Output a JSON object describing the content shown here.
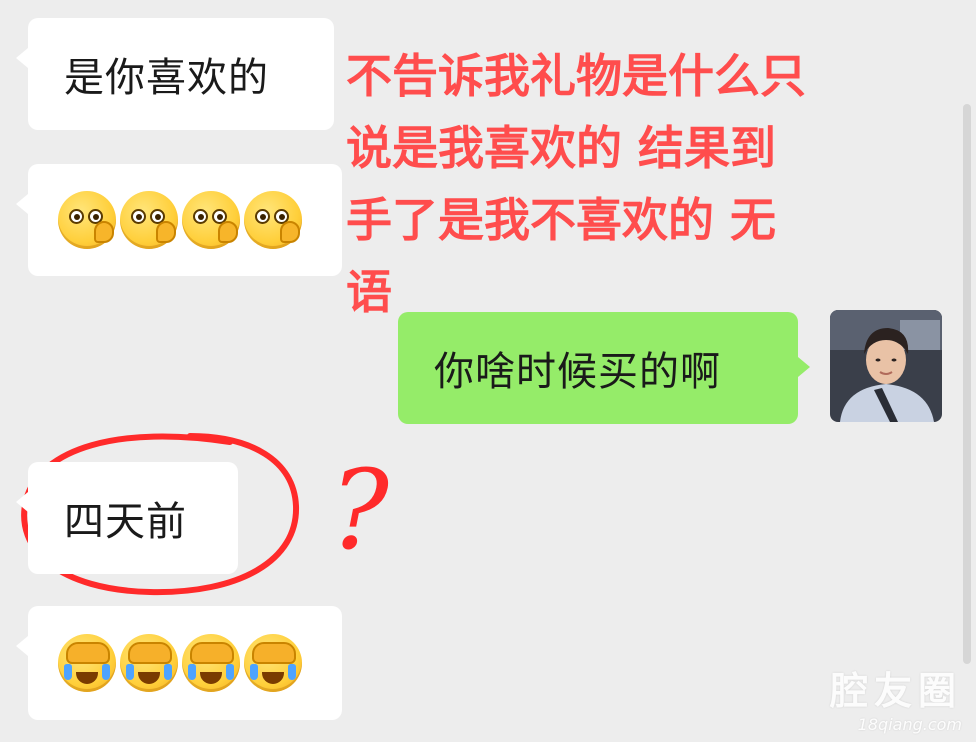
{
  "messages": [
    {
      "side": "left",
      "text": "是你喜欢的"
    },
    {
      "side": "left",
      "emoji": [
        "peeking-face-icon",
        "peeking-face-icon",
        "peeking-face-icon",
        "peeking-face-icon"
      ]
    },
    {
      "side": "right",
      "text": "你啥时候买的啊"
    },
    {
      "side": "left",
      "text": "四天前"
    },
    {
      "side": "left",
      "emoji": [
        "facepalm-crying-icon",
        "facepalm-crying-icon",
        "facepalm-crying-icon",
        "facepalm-crying-icon"
      ]
    }
  ],
  "annotation": {
    "text": "不告诉我礼物是什么只\n说是我喜欢的 结果到\n手了是我不喜欢的 无\n语",
    "question_mark": "?",
    "color": "#ff4d4d"
  },
  "colors": {
    "background": "#ededed",
    "bubble_left": "#ffffff",
    "bubble_right": "#95ec69",
    "annotation_red": "#ff4d4d"
  },
  "watermark": {
    "main": "腔友圈",
    "sub": "18qiang.com"
  }
}
